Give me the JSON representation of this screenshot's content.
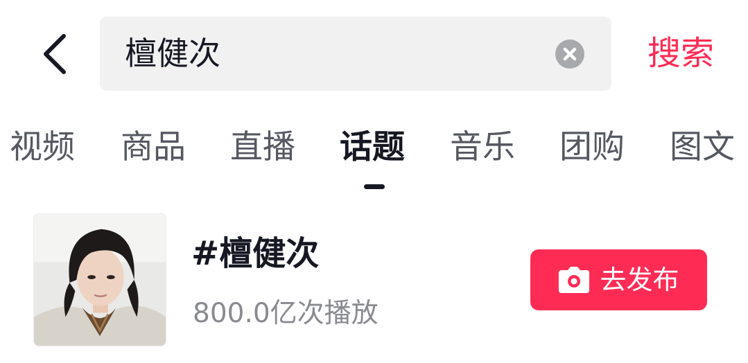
{
  "header": {
    "back_icon": "chevron-left-icon",
    "search": {
      "value": "檀健次",
      "clear_icon": "clear-circle-icon"
    },
    "search_button_label": "搜索"
  },
  "tabs": [
    {
      "label": "视频",
      "active": false
    },
    {
      "label": "商品",
      "active": false
    },
    {
      "label": "直播",
      "active": false
    },
    {
      "label": "话题",
      "active": true
    },
    {
      "label": "音乐",
      "active": false
    },
    {
      "label": "团购",
      "active": false
    },
    {
      "label": "图文",
      "active": false
    }
  ],
  "topic": {
    "title": "#檀健次",
    "stats": "800.0亿次播放",
    "avatar": "person-photo",
    "publish_button": {
      "icon": "camera-icon",
      "label": "去发布"
    }
  },
  "colors": {
    "accent": "#fe2c55",
    "text_primary": "#161823",
    "text_secondary": "#8a8b91",
    "search_bg": "#f1f1f2"
  }
}
